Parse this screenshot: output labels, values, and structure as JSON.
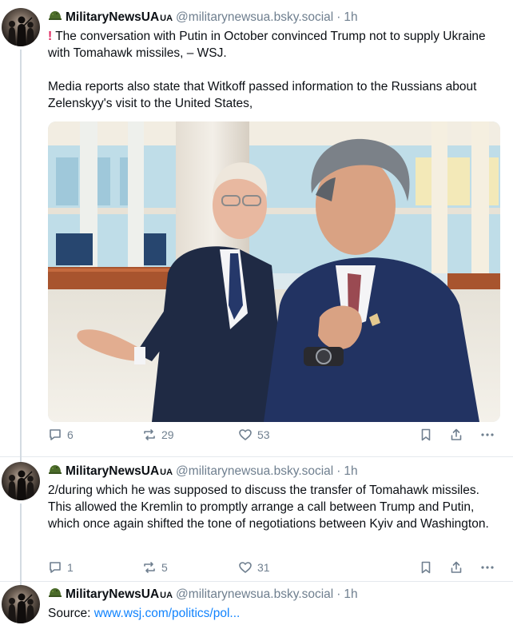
{
  "posts": [
    {
      "author": {
        "display_name": "MilitaryNewsUA",
        "badge": "UA",
        "handle": "@militarynewsua.bsky.social",
        "time": "1h",
        "avatar_icon": "soldiers-silhouette-avatar",
        "emoji_icon": "military-helmet-icon"
      },
      "text": {
        "alert_icon": "!",
        "line1": "The conversation with Putin in October convinced Trump not to supply Ukraine with Tomahawk missiles, – WSJ.",
        "line2": "Media reports also state that Witkoff passed information to the Russians about Zelenskyy's visit to the United States,"
      },
      "media": {
        "icon": "photo-two-men-in-palace-hall"
      },
      "stats": {
        "replies": "6",
        "reposts": "29",
        "likes": "53"
      }
    },
    {
      "author": {
        "display_name": "MilitaryNewsUA",
        "badge": "UA",
        "handle": "@militarynewsua.bsky.social",
        "time": "1h"
      },
      "text": {
        "line1": "2/during which he was supposed to discuss the transfer of Tomahawk missiles. This allowed the Kremlin to promptly arrange a call between Trump and Putin, which once again shifted the tone of negotiations between Kyiv and Washington."
      },
      "stats": {
        "replies": "1",
        "reposts": "5",
        "likes": "31"
      }
    },
    {
      "author": {
        "display_name": "MilitaryNewsUA",
        "badge": "UA",
        "handle": "@militarynewsua.bsky.social",
        "time": "1h"
      },
      "text": {
        "prefix": "Source: ",
        "link": "www.wsj.com/politics/pol..."
      }
    }
  ],
  "colors": {
    "text": "#0b0f14",
    "muted": "#6f7f8f",
    "link": "#1083fe",
    "alert": "#e0245e",
    "divider": "#e5e9ee",
    "thread_line": "#d4dbe2"
  },
  "separator": "·"
}
